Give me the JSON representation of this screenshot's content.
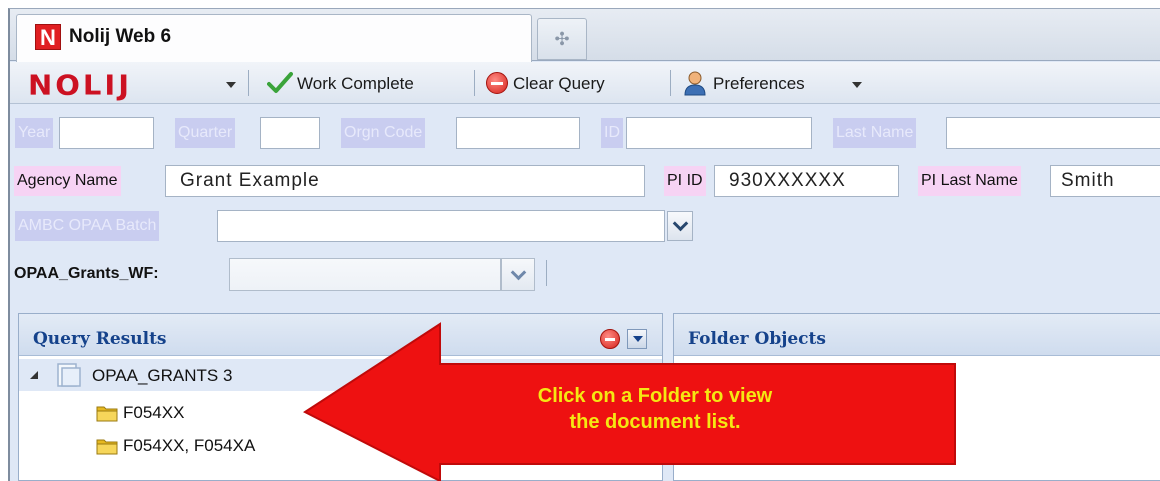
{
  "tabs": {
    "active_title": "Nolij Web 6",
    "logo_letter": "N",
    "new_tab_glyph": "✣"
  },
  "toolbar": {
    "brand": "NOLIJ",
    "work_complete": "Work Complete",
    "clear_query": "Clear Query",
    "preferences": "Preferences"
  },
  "query": {
    "year_label": "Year",
    "quarter_label": "Quarter",
    "orgn_code_label": "Orgn Code",
    "id_label": "ID",
    "last_name_label": "Last Name",
    "agency_name_label": "Agency Name",
    "agency_name_value": "Grant Example",
    "pi_id_label": "PI ID",
    "pi_id_value": "930XXXXXX",
    "pi_last_name_label": "PI Last Name",
    "pi_last_name_value": "Smith",
    "batch_label": "AMBC OPAA Batch"
  },
  "workflow": {
    "label": "OPAA_Grants_WF:",
    "value": ""
  },
  "query_results": {
    "title": "Query Results",
    "root": "OPAA_GRANTS 3",
    "folders": [
      "F054XX",
      "F054XX, F054XA"
    ]
  },
  "folder_objects": {
    "title": "Folder Objects"
  },
  "callout": {
    "line1": "Click on a Folder to view",
    "line2": "the document list."
  },
  "colors": {
    "brand_red": "#cc1122",
    "header_blue": "#15428b",
    "arrow_red": "#ee1111",
    "callout_yellow": "#f5e812",
    "label_pink": "#f6d3f4",
    "label_lavender": "#c9cdf0"
  }
}
